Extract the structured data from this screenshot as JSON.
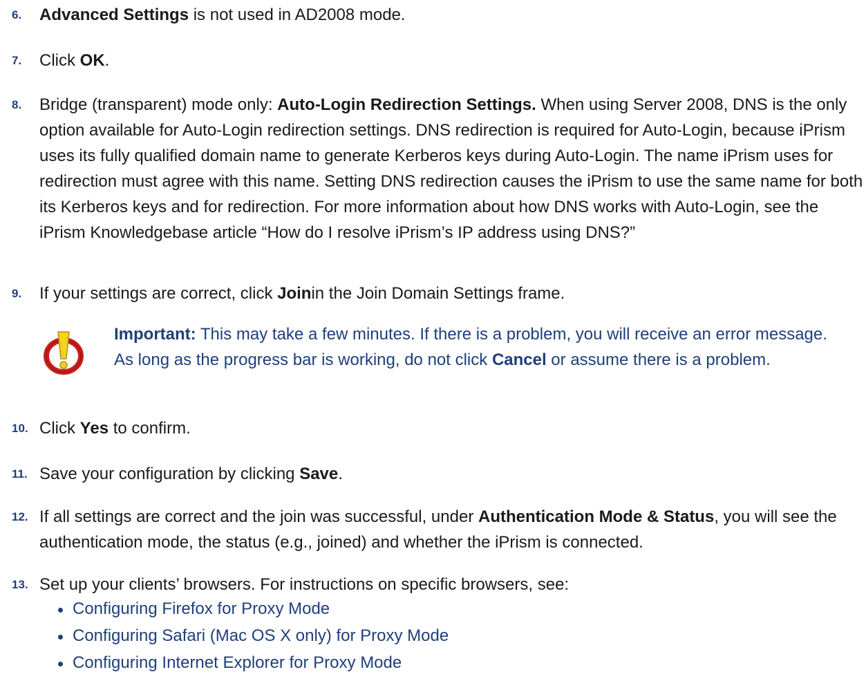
{
  "steps": [
    {
      "num": "6.",
      "parts": [
        [
          "b",
          "Advanced Settings"
        ],
        [
          "t",
          " is not used in AD2008 mode."
        ]
      ]
    },
    {
      "num": "7.",
      "parts": [
        [
          "t",
          "Click "
        ],
        [
          "b",
          "OK"
        ],
        [
          "t",
          "."
        ]
      ]
    },
    {
      "num": "8.",
      "parts": [
        [
          "t",
          "Bridge (transparent) mode only: "
        ],
        [
          "b",
          "Auto-Login Redirection Settings."
        ],
        [
          "t",
          " When using Server 2008, DNS is the only option available for Auto-Login redirection settings. DNS redirection is required for Auto-Login, because iPrism uses its fully qualified domain name to generate Kerberos keys during Auto-Login. The name iPrism uses for redirection must agree with this name. Setting DNS redirection causes the iPrism to use the same name for both its Kerberos keys and for redirection. For more information about how DNS works with Auto-Login, see the iPrism Knowledgebase article “How do I resolve iPrism’s IP address using DNS?”"
        ]
      ]
    },
    {
      "num": "9.",
      "parts": [
        [
          "t",
          "If your settings are correct, click "
        ],
        [
          "b",
          "Join"
        ],
        [
          "t",
          "in the Join Domain Settings frame."
        ]
      ]
    },
    {
      "num": "10.",
      "parts": [
        [
          "t",
          "Click "
        ],
        [
          "b",
          "Yes"
        ],
        [
          "t",
          " to confirm."
        ]
      ]
    },
    {
      "num": "11.",
      "parts": [
        [
          "t",
          "Save your configuration by clicking "
        ],
        [
          "b",
          "Save"
        ],
        [
          "t",
          "."
        ]
      ]
    },
    {
      "num": "12.",
      "parts": [
        [
          "t",
          "If all settings are correct and the join was successful, under "
        ],
        [
          "b",
          "Authentication Mode & Status"
        ],
        [
          "t",
          ", you will see the authentication mode, the status (e.g., joined) and whether the iPrism is connected."
        ]
      ]
    },
    {
      "num": "13.",
      "parts": [
        [
          "t",
          "Set up your clients’ browsers. For instructions on specific browsers, see:"
        ]
      ]
    }
  ],
  "callout": {
    "icon": "warning-icon",
    "label": "Important:",
    "text_before": " This may take a few minutes. If there is a problem, you will receive an error message. As long as the progress bar is working, do not click ",
    "bold": "Cancel",
    "text_after": " or assume there is a problem."
  },
  "links": [
    "Configuring Firefox for Proxy Mode",
    "Configuring Safari (Mac OS X only) for Proxy Mode",
    "Configuring Internet Explorer for Proxy Mode"
  ],
  "colors": {
    "accent": "#1f3f7a",
    "icon_red": "#c9201f",
    "icon_yellow": "#f5d21b"
  }
}
